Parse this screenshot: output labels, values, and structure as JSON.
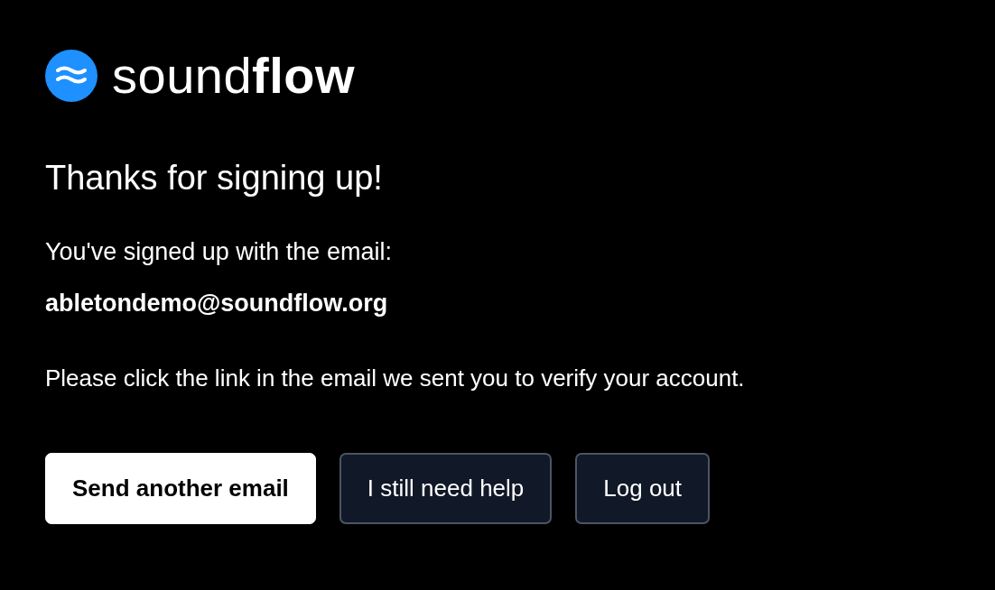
{
  "logo": {
    "text": "sound**flow**"
  },
  "heading": "Thanks for signing up!",
  "intro": "You've signed up with the email:",
  "email": "abletondemo@soundflow.org",
  "instruction": "Please click the link in the email we sent you to verify your account.",
  "buttons": [
    {
      "label": "Send another email",
      "kind": "primary"
    },
    {
      "label": "I still need help",
      "kind": "secondary"
    },
    {
      "label": "Log out",
      "kind": "secondary"
    }
  ]
}
